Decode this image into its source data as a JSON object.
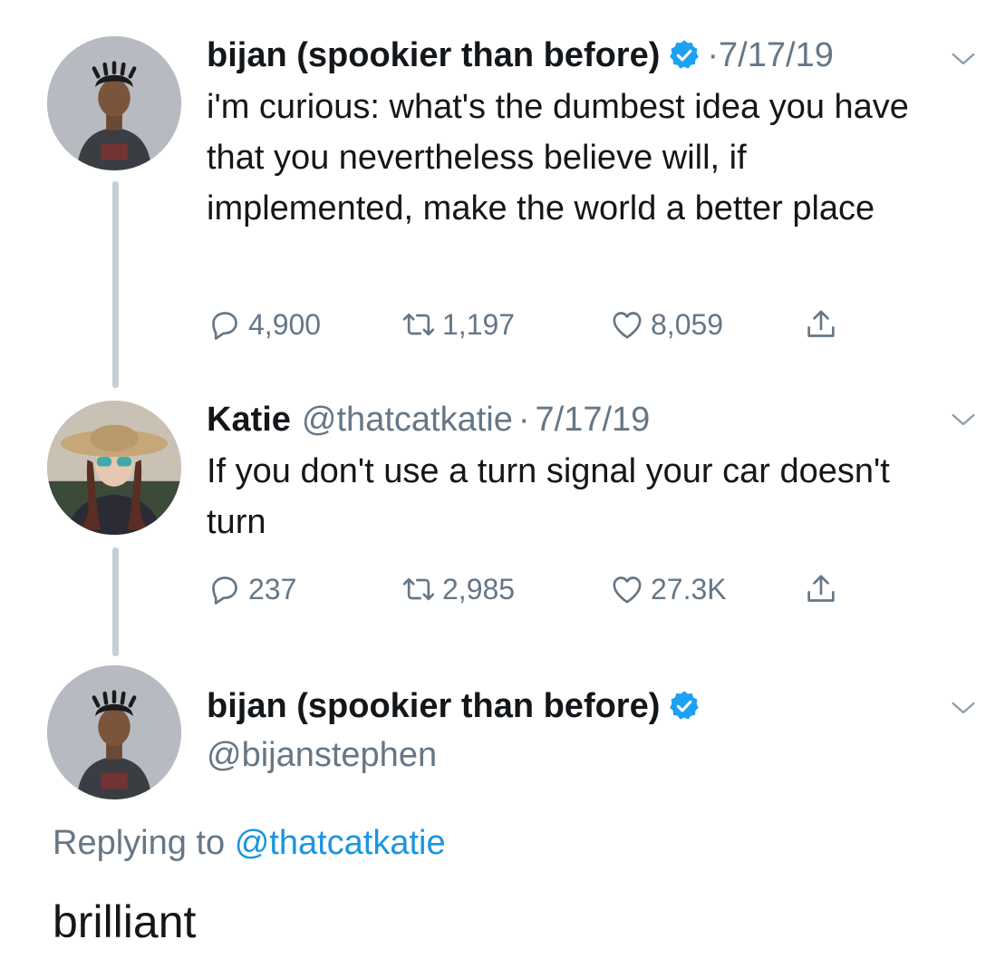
{
  "tweets": [
    {
      "name": "bijan (spookier than before)",
      "verified": true,
      "date": "7/17/19",
      "text": "i'm curious: what's the dumbest idea you have that you nevertheless believe will, if implemented, make the world a better place",
      "replies": "4,900",
      "retweets": "1,197",
      "likes": "8,059"
    },
    {
      "name": "Katie",
      "handle": "@thatcatkatie",
      "date": "7/17/19",
      "text": "If you don't use a turn signal your car doesn't turn",
      "replies": "237",
      "retweets": "2,985",
      "likes": "27.3K"
    }
  ],
  "main_tweet": {
    "name": "bijan (spookier than before)",
    "handle": "@bijanstephen",
    "verified": true,
    "replying_prefix": "Replying to",
    "replying_handle": "@thatcatkatie",
    "text": "brilliant"
  },
  "colors": {
    "verified_blue": "#1da1f2",
    "link_blue": "#1b95e0",
    "meta_gray": "#657786",
    "thread_line": "#c4cfd6"
  },
  "icons": [
    "reply-icon",
    "retweet-icon",
    "like-icon",
    "share-icon",
    "verified-icon",
    "chevron-down-icon"
  ]
}
